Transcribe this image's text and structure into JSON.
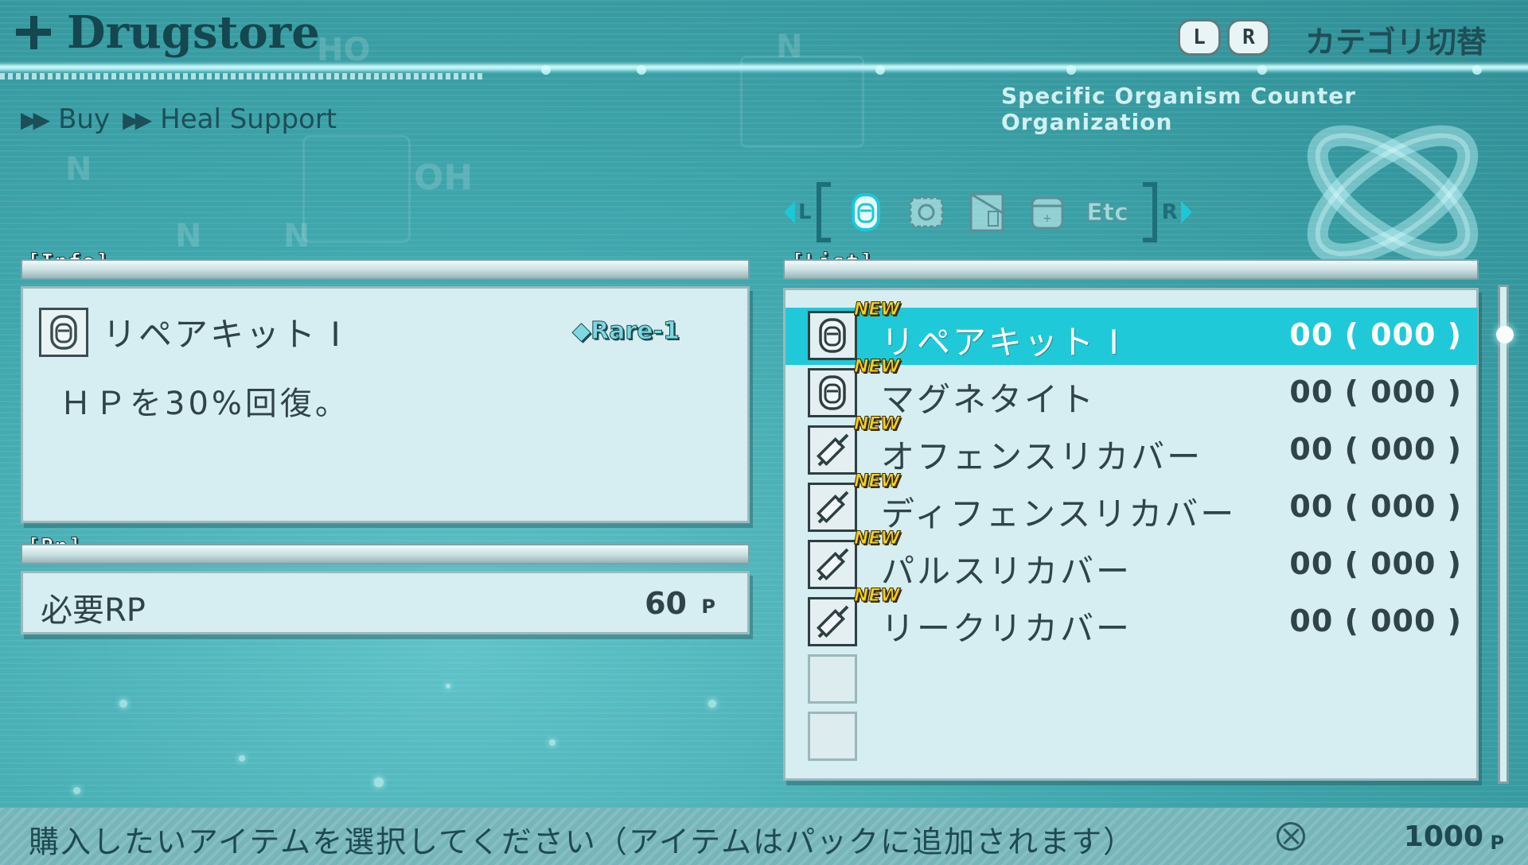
{
  "header": {
    "title": "Drugstore",
    "key_l": "L",
    "key_r": "R",
    "category_switch": "カテゴリ切替",
    "organization": "Specific Organism Counter Organization"
  },
  "breadcrumb": {
    "level1": "Buy",
    "level2": "Heal Support"
  },
  "category_tabs": {
    "left_key": "L",
    "right_key": "R",
    "icons": [
      "bottle-icon",
      "gear-icon",
      "book-icon",
      "container-icon",
      "etc-icon"
    ],
    "etc_label": "Etc"
  },
  "info": {
    "section_label": "[Info]",
    "item_name": "リペアキット I",
    "rarity": "Rare-1",
    "description": "ＨＰを30%回復。"
  },
  "rp": {
    "section_label": "[Rp]",
    "label": "必要RP",
    "value": "60",
    "unit": "P"
  },
  "list": {
    "section_label": "[List]",
    "items": [
      {
        "icon": "bottle-icon",
        "badge": "NEW",
        "name": "リペアキット I",
        "qty": "00 ( 000 )",
        "selected": true
      },
      {
        "icon": "bottle-icon",
        "badge": "NEW",
        "name": "マグネタイト",
        "qty": "00 ( 000 )",
        "selected": false
      },
      {
        "icon": "syringe-icon",
        "badge": "NEW",
        "name": "オフェンスリカバー",
        "qty": "00 ( 000 )",
        "selected": false
      },
      {
        "icon": "syringe-icon",
        "badge": "NEW",
        "name": "ディフェンスリカバー",
        "qty": "00 ( 000 )",
        "selected": false
      },
      {
        "icon": "syringe-icon",
        "badge": "NEW",
        "name": "パルスリカバー",
        "qty": "00 ( 000 )",
        "selected": false
      },
      {
        "icon": "syringe-icon",
        "badge": "NEW",
        "name": "リークリカバー",
        "qty": "00 ( 000 )",
        "selected": false
      }
    ]
  },
  "footer": {
    "instruction": "購入したいアイテムを選択してください（アイテムはパックに追加されます）",
    "money": "1000",
    "unit": "P"
  },
  "colors": {
    "accent": "#20c9d8",
    "background": "#3fa7ad",
    "panel": "#d6edf1",
    "new_badge": "#f2d21a"
  }
}
